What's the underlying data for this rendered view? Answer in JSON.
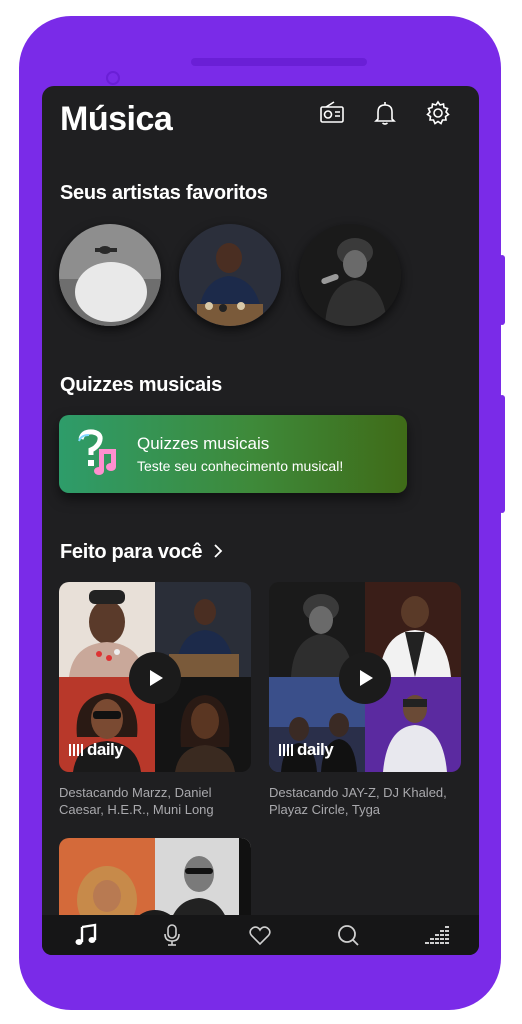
{
  "header": {
    "title": "Música"
  },
  "icons": {
    "radio": "radio-icon",
    "bell": "bell-icon",
    "settings": "gear-icon"
  },
  "favorites": {
    "title": "Seus artistas favoritos"
  },
  "quizzes": {
    "section_title": "Quizzes musicais",
    "card_title": "Quizzes musicais",
    "card_subtitle": "Teste seu conhecimento musical!"
  },
  "made_for_you": {
    "title": "Feito para você",
    "cards": [
      {
        "badge": "daily",
        "description": "Destacando Marzz, Daniel Caesar, H.E.R., Muni Long"
      },
      {
        "badge": "daily",
        "description": "Destacando JAY-Z, DJ Khaled, Playaz Circle, Tyga"
      }
    ]
  },
  "nav": [
    "music-note-icon",
    "microphone-icon",
    "heart-icon",
    "search-icon",
    "equalizer-icon"
  ],
  "colors": {
    "accent": "#7a2be8",
    "background": "#1f1f21",
    "quiz_start": "#2e9c6a",
    "quiz_end": "#3f6b18"
  }
}
